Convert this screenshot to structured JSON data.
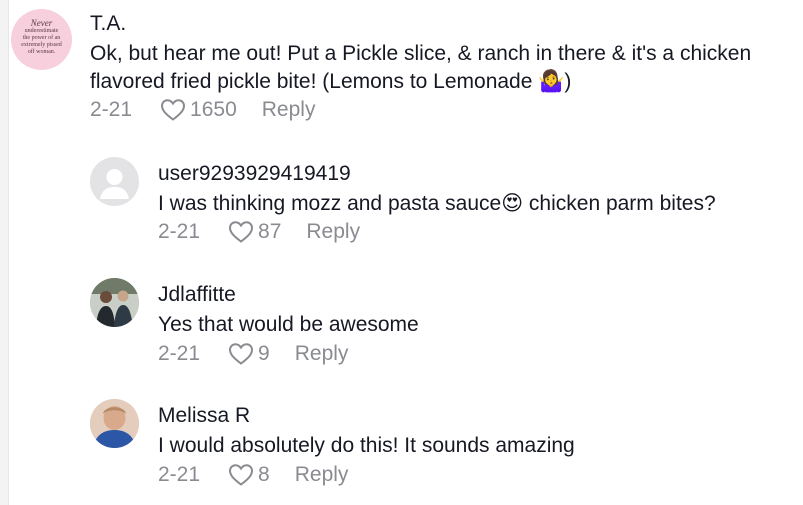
{
  "comments": [
    {
      "username": "T.A.",
      "text": "Ok, but hear me out! Put a Pickle slice, & ranch in there & it's a chicken flavored fried pickle bite! (Lemons to Lemonade 🤷‍♀️)",
      "date": "2-21",
      "likes": "1650",
      "reply_label": "Reply",
      "avatar_text": [
        "Never",
        "underestimate",
        "the power of an",
        "extremely pissed",
        "off woman."
      ]
    },
    {
      "username": "user9293929419419",
      "text": "I was thinking mozz and pasta sauce😍 chicken parm bites?",
      "date": "2-21",
      "likes": "87",
      "reply_label": "Reply"
    },
    {
      "username": "Jdlaffitte",
      "text": "Yes that would be awesome",
      "date": "2-21",
      "likes": "9",
      "reply_label": "Reply"
    },
    {
      "username": "Melissa R",
      "text": "I would absolutely do this! It sounds amazing",
      "date": "2-21",
      "likes": "8",
      "reply_label": "Reply"
    }
  ],
  "colors": {
    "text": "#161823",
    "muted": "#8a8b91",
    "avatar_pink": "#f6c9d6",
    "avatar_grey": "#e3e3e5"
  }
}
